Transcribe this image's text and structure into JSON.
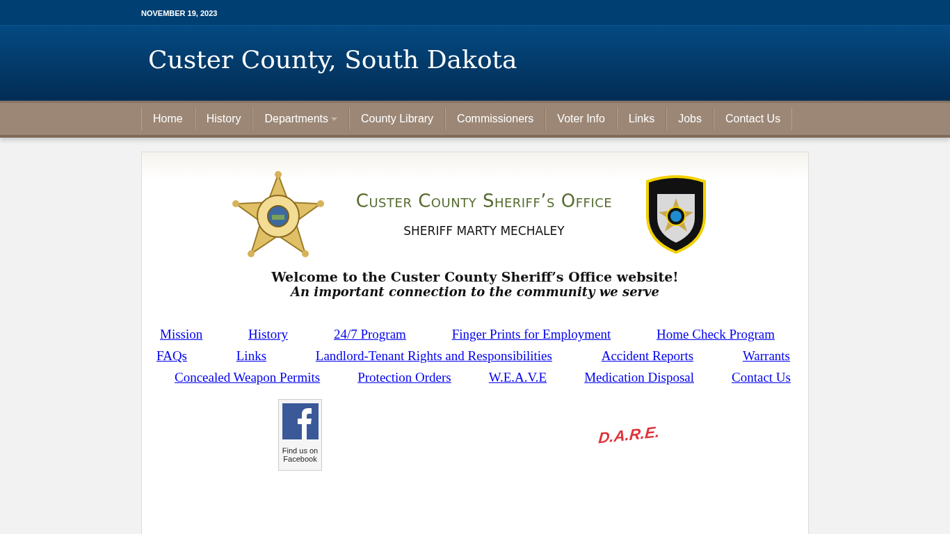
{
  "date": "NOVEMBER 19, 2023",
  "site_title": "Custer County, South Dakota",
  "nav": [
    {
      "label": "Home",
      "has_submenu": false
    },
    {
      "label": "History",
      "has_submenu": false
    },
    {
      "label": "Departments",
      "has_submenu": true
    },
    {
      "label": "County Library",
      "has_submenu": false
    },
    {
      "label": "Commissioners",
      "has_submenu": false
    },
    {
      "label": "Voter Info",
      "has_submenu": false
    },
    {
      "label": "Links",
      "has_submenu": false
    },
    {
      "label": "Jobs",
      "has_submenu": false
    },
    {
      "label": "Contact Us",
      "has_submenu": false
    }
  ],
  "banner": {
    "heading": "Custer County Sheriff’s Office",
    "sheriff": "SHERIFF MARTY MECHALEY"
  },
  "welcome": "Welcome to the Custer County Sheriff’s Office website!",
  "tagline": "An important connection to the community we serve",
  "link_rows": [
    [
      "Mission",
      "History",
      "24/7 Program",
      "Finger Prints for Employment",
      "Home Check Program"
    ],
    [
      "FAQs",
      "Links",
      "Landlord-Tenant Rights and Responsibilities",
      "Accident Reports",
      "Warrants"
    ],
    [
      "Concealed Weapon Permits",
      "Protection Orders",
      "W.E.A.V.E",
      "Medication Disposal",
      "Contact Us"
    ]
  ],
  "facebook": {
    "caption": "Find us on Facebook"
  },
  "dare": "D.A.R.E."
}
